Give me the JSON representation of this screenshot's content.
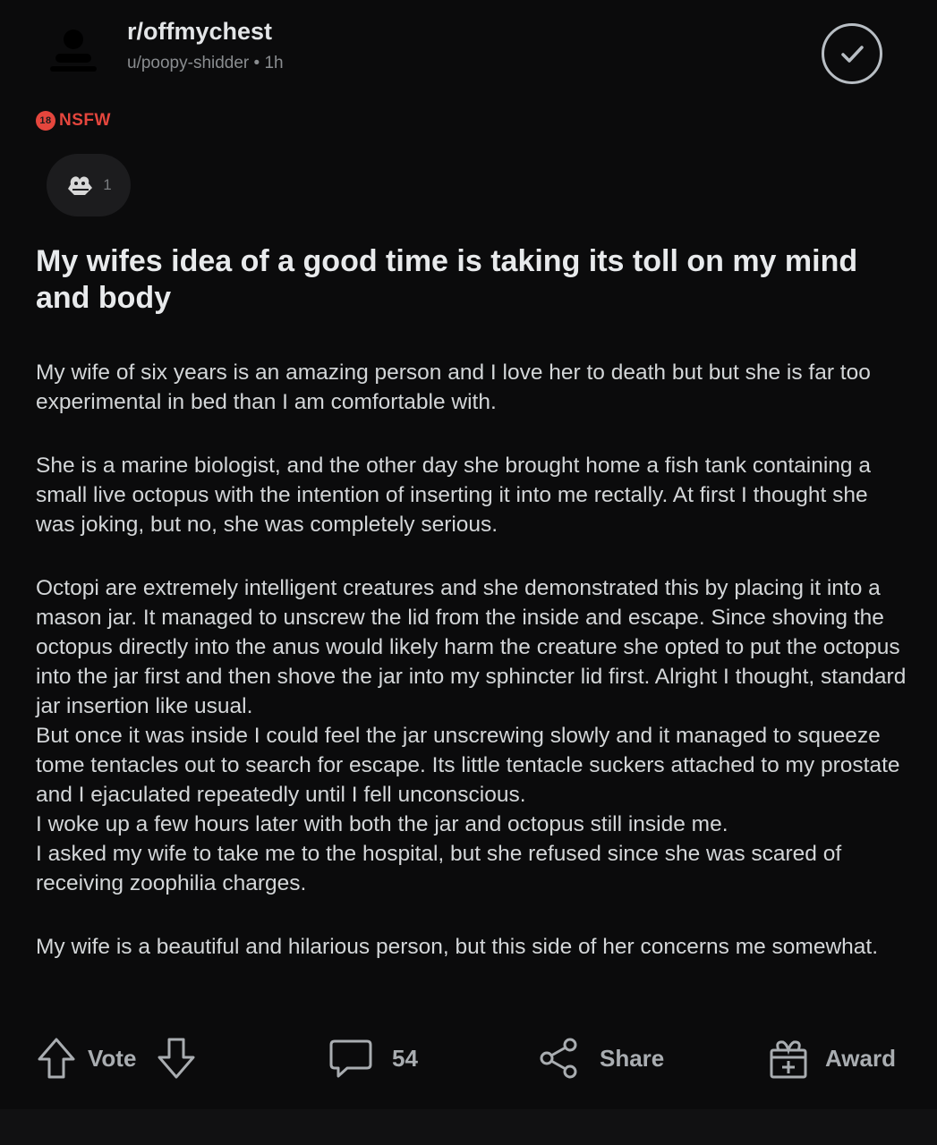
{
  "header": {
    "subreddit": "r/offmychest",
    "author": "u/poopy-shidder",
    "separator": "•",
    "time_ago": "1h",
    "joined_icon": "checkmark-circle-icon"
  },
  "nsfw_badge": {
    "icon_text": "18",
    "label": "NSFW"
  },
  "award_chip": {
    "icon": "award-icon",
    "count": "1"
  },
  "post": {
    "title": "My wifes idea of a good time is taking its toll on my mind and body",
    "paragraphs": [
      "My wife of six years is an amazing person and I love her to death but but she is far too experimental in bed than I am comfortable with.",
      "She is a marine biologist, and the other day she brought home a fish tank containing a small live octopus with the intention of inserting it into me rectally. At first I thought she was joking, but no, she was completely serious.",
      "Octopi are extremely intelligent creatures and she demonstrated this by placing it into a mason jar. It managed to unscrew the lid from the inside and escape. Since shoving the octopus directly into the anus would likely harm the creature she opted to put the octopus into the jar first and then shove the jar into my sphincter lid first. Alright I thought, standard jar insertion like usual.\nBut once it was inside I could feel the jar unscrewing slowly and it managed to squeeze tome tentacles out to search for escape. Its little tentacle suckers attached to my prostate and I ejaculated repeatedly until I fell unconscious.\nI woke up a few hours later with both the jar and octopus still inside me.\nI asked my wife to take me to the hospital, but she refused since she was scared of receiving zoophilia charges.",
      "My wife is a beautiful and hilarious person, but this side of her concerns me somewhat."
    ]
  },
  "actions": {
    "upvote_icon": "upvote-arrow-icon",
    "vote_label": "Vote",
    "downvote_icon": "downvote-arrow-icon",
    "comment_icon": "comment-bubble-icon",
    "comment_count": "54",
    "share_icon": "share-icon",
    "share_label": "Share",
    "award_icon": "gift-award-icon",
    "award_label": "Award"
  },
  "colors": {
    "background": "#0b0b0c",
    "text": "#d7dadc",
    "muted": "#8a8d90",
    "nsfw": "#e4463d"
  }
}
